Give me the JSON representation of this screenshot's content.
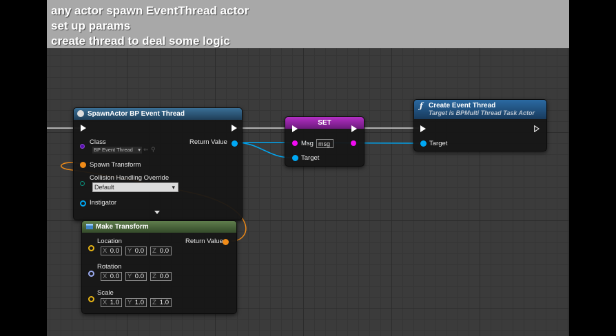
{
  "comment": {
    "lines": [
      "any actor spawn EventThread actor",
      "set up params",
      "create thread to deal some logic"
    ]
  },
  "colors": {
    "object_pin": "#00a8f4",
    "struct_pin": "#f08b18",
    "string_pin": "#f10bf2",
    "class_pin": "#5a0eab",
    "enum_pin": "#0b6b5c",
    "vector_pin": "#e8b515",
    "rotator_pin": "#9aaaf0",
    "spawn_header": "#2d5a7c",
    "set_header": "#a12ab0",
    "create_header": "#235a8a",
    "make_header": "#4e6a3e"
  },
  "spawn_node": {
    "icon": "spawn-icon",
    "title": "SpawnActor BP Event Thread",
    "class_label": "Class",
    "class_value": "BP Event Thread",
    "return_label": "Return Value",
    "spawn_transform_label": "Spawn Transform",
    "collision_label": "Collision Handling Override",
    "collision_value": "Default",
    "instigator_label": "Instigator"
  },
  "set_node": {
    "title": "SET",
    "msg_label": "Msg",
    "msg_value": "msg",
    "target_label": "Target"
  },
  "create_node": {
    "icon": "function-icon",
    "title": "Create Event Thread",
    "subtitle": "Target is BPMulti Thread Task Actor",
    "target_label": "Target"
  },
  "make_node": {
    "icon": "make-struct-icon",
    "title": "Make Transform",
    "return_label": "Return Value",
    "location_label": "Location",
    "rotation_label": "Rotation",
    "scale_label": "Scale",
    "axes": [
      "X",
      "Y",
      "Z"
    ],
    "location": [
      "0.0",
      "0.0",
      "0.0"
    ],
    "rotation": [
      "0.0",
      "0.0",
      "0.0"
    ],
    "scale": [
      "1.0",
      "1.0",
      "1.0"
    ]
  }
}
